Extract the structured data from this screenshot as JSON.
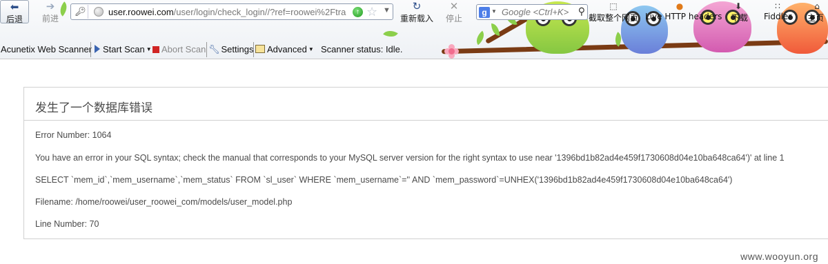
{
  "browser": {
    "back_label": "后退",
    "forward_label": "前进",
    "url_host": "user.roowei.com",
    "url_path": "/user/login/check_login//?ref=roowei%2Ftra",
    "reload_label": "重新载入",
    "stop_label": "停止",
    "search_engine_letter": "g",
    "search_placeholder": "Google <Ctrl+K>",
    "toolbar_items": {
      "screenshot": "截取整个网页",
      "live_http": "Live HTTP headers",
      "download": "下载",
      "fiddler": "Fiddler",
      "home": "主页"
    }
  },
  "acunetix": {
    "title": "Acunetix Web Scanner",
    "start_scan": "Start Scan",
    "abort_scan": "Abort Scan",
    "settings": "Settings",
    "advanced": "Advanced",
    "status": "Scanner status: Idle."
  },
  "error": {
    "heading": "发生了一个数据库错误",
    "number": "Error Number: 1064",
    "message": "You have an error in your SQL syntax; check the manual that corresponds to your MySQL server version for the right syntax to use near '1396bd1b82ad4e459f1730608d04e10ba648ca64')' at line 1",
    "query": "SELECT `mem_id`,`mem_username`,`mem_status` FROM `sl_user` WHERE `mem_username`='' AND `mem_password`=UNHEX('1396bd1b82ad4e459f1730608d04e10ba648ca64')",
    "filename": "Filename: /home/roowei/user_roowei_com/models/user_model.php",
    "line": "Line Number: 70"
  },
  "watermark": "www.wooyun.org",
  "colors": {
    "panel_border": "#d0d0d0",
    "text": "#4a4a4a",
    "branch": "#7a3b14"
  }
}
